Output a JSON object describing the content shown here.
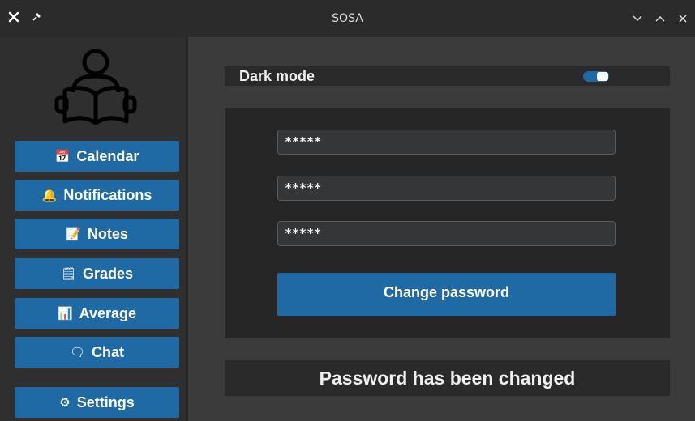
{
  "window": {
    "title": "SOSA",
    "close_icon": "close-icon",
    "pin_icon": "pin-icon",
    "minimize_icon": "chevron-down-icon",
    "maximize_icon": "chevron-up-icon",
    "close_right_icon": "close-icon"
  },
  "sidebar": {
    "logo_icon": "person-reading-book-icon",
    "items": [
      {
        "label": "Calendar",
        "icon": "📅"
      },
      {
        "label": "Notifications",
        "icon": "🔔"
      },
      {
        "label": "Notes",
        "icon": "📝"
      },
      {
        "label": "Grades",
        "icon": "🗒"
      },
      {
        "label": "Average",
        "icon": "📊"
      },
      {
        "label": "Chat",
        "icon": "🗨"
      },
      {
        "label": "Settings",
        "icon": "⚙"
      }
    ]
  },
  "settings": {
    "dark_mode_label": "Dark mode",
    "dark_mode_on": true,
    "current_password": "*****",
    "new_password": "*****",
    "confirm_password": "*****",
    "change_password_label": "Change password",
    "status_message": "Password has been changed"
  },
  "colors": {
    "accent": "#1f6aa5",
    "background": "#3b3b3b",
    "sidebar": "#2f2f2f",
    "panel": "#262626"
  }
}
